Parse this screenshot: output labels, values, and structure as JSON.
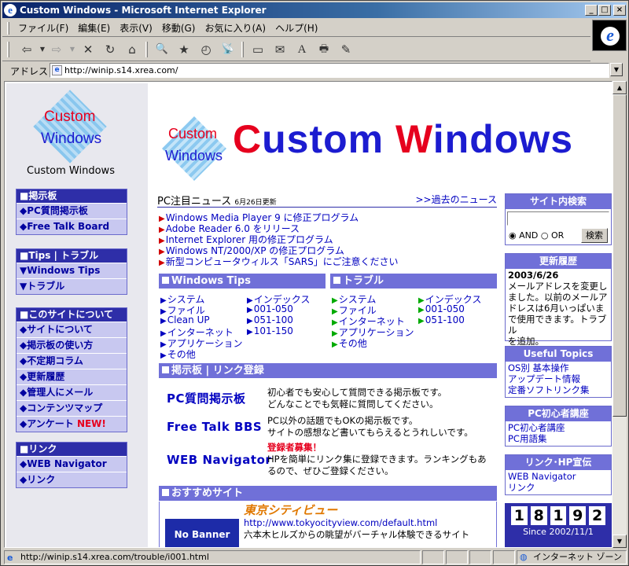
{
  "window": {
    "title": "Custom Windows - Microsoft Internet Explorer",
    "controls": [
      "_",
      "□",
      "×"
    ]
  },
  "menu": [
    "ファイル(F)",
    "編集(E)",
    "表示(V)",
    "移動(G)",
    "お気に入り(A)",
    "ヘルプ(H)"
  ],
  "toolbar": {
    "icons": [
      "back-icon",
      "forward-icon",
      "stop-icon",
      "refresh-icon",
      "home-icon",
      "search-icon",
      "favorites-icon",
      "history-icon",
      "channels-icon",
      "fullscreen-icon",
      "mail-icon",
      "font-icon",
      "print-icon",
      "edit-icon"
    ],
    "glyphs": [
      "⇦",
      "⇨",
      "✕",
      "↻",
      "⌂",
      "🔍",
      "★",
      "◴",
      "📡",
      "▭",
      "✉",
      "A",
      "🖶",
      "✎"
    ]
  },
  "address": {
    "label": "アドレス",
    "value": "http://winip.s14.xrea.com/"
  },
  "status": {
    "url": "http://winip.s14.xrea.com/trouble/i001.html",
    "zone": "インターネット ゾーン"
  },
  "sidebar": {
    "logo_text1": "Custom",
    "logo_text2": "Windows",
    "site_name": "Custom Windows",
    "boxes": [
      {
        "title": "■掲示板",
        "items": [
          "◆PC質問掲示板",
          "◆Free Talk Board"
        ]
      },
      {
        "title": "■Tips | トラブル",
        "items": [
          "▼Windows Tips",
          "▼トラブル"
        ]
      },
      {
        "title": "■このサイトについて",
        "items": [
          "◆サイトについて",
          "◆掲示板の使い方",
          "◆不定期コラム",
          "◆更新履歴",
          "◆管理人にメール",
          "◆コンテンツマップ",
          "◆アンケート"
        ]
      },
      {
        "title": "■リンク",
        "items": [
          "◆WEB Navigator",
          "◆リンク"
        ]
      }
    ],
    "new_badge": "NEW!"
  },
  "header": {
    "logo_c": "Custom",
    "logo_w": "Windows",
    "banner_part1": "C",
    "banner_part2": "ustom ",
    "banner_part3": "W",
    "banner_part4": "indows"
  },
  "news": {
    "title": "PC注目ニュース",
    "date": "6月26日更新",
    "past_link": ">>過去のニュース",
    "items": [
      "Windows Media Player 9 に修正プログラム",
      "Adobe Reader 6.0 をリリース",
      "Internet Explorer 用の修正プログラム",
      "Windows NT/2000/XP の修正プログラム",
      "新型コンピュータウィルス「SARS」にご注意ください"
    ]
  },
  "tips": {
    "title": "Windows Tips",
    "col1": [
      "システム",
      "ファイル",
      "Clean UP",
      "インターネット",
      "アプリケーション",
      "その他"
    ],
    "col2": [
      "インデックス",
      "001-050",
      "051-100",
      "101-150"
    ]
  },
  "trouble": {
    "title": "トラブル",
    "col1": [
      "システム",
      "ファイル",
      "インターネット",
      "アプリケーション",
      "その他"
    ],
    "col2": [
      "インデックス",
      "001-050",
      "051-100"
    ]
  },
  "boards": {
    "title": "掲示板 | リンク登録",
    "items": [
      {
        "link": "PC質問掲示板",
        "line1": "初心者でも安心して質問できる掲示板です。",
        "line2": "どんなことでも気軽に質問してください。"
      },
      {
        "link": "Free Talk BBS",
        "line1": "PC以外の話題でもOKの掲示板です。",
        "line2": "サイトの感想など書いてもらえるとうれしいです。"
      },
      {
        "link": "WEB Navigator",
        "badge": "登録者募集！",
        "line1": "HPを簡単にリンク集に登録できます。ランキングもあ",
        "line2": "るので、ぜひご登録ください。"
      }
    ]
  },
  "recommend": {
    "title": "おすすめサイト",
    "banner": "No Banner",
    "site_name": "東京シティビュー",
    "url": "http://www.tokyocityview.com/default.html",
    "desc": "六本木ヒルズからの眺望がバーチャル体験できるサイト"
  },
  "search": {
    "title": "サイト内検索",
    "input_value": "",
    "and_label": "AND",
    "or_label": "OR",
    "button": "検索"
  },
  "history": {
    "title": "更新履歴",
    "date": "2003/6/26",
    "lines": [
      "メールアドレスを変更し",
      "ました。以前のメールア",
      "ドレスは6月いっぱいま",
      "で使用できます。トラブル",
      "を追加。"
    ]
  },
  "useful": {
    "title": "Useful Topics",
    "items": [
      "OS別 基本操作",
      "アップデート情報",
      "定番ソフトリンク集"
    ]
  },
  "beginner": {
    "title": "PC初心者講座",
    "items": [
      "PC初心者講座",
      "PC用語集"
    ]
  },
  "links_box": {
    "title": "リンク･HP宣伝",
    "items": [
      "WEB Navigator",
      "リンク"
    ]
  },
  "counter": {
    "digits": [
      "1",
      "8",
      "1",
      "9",
      "2"
    ],
    "since": "Since 2002/11/1"
  },
  "colors": {
    "title_bar": "#0a246a",
    "section_blue": "#7070d8",
    "link": "#0000c0",
    "red": "#e6001e"
  }
}
